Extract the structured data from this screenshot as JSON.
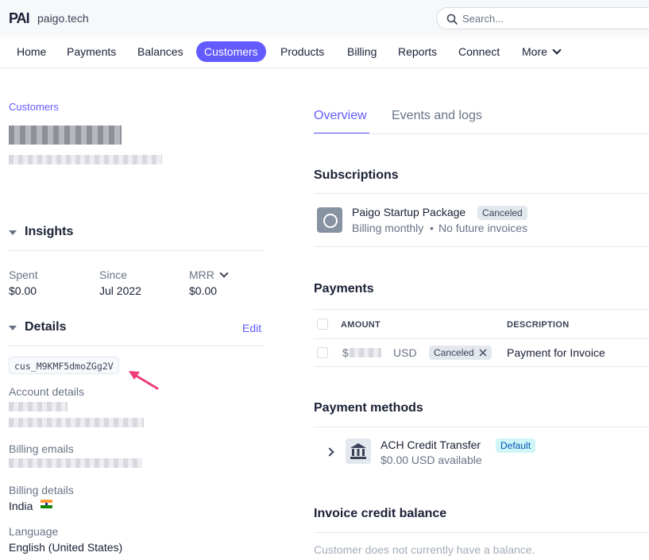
{
  "topbar": {
    "logo_text": "PAI",
    "account_name": "paigo.tech",
    "search_placeholder": "Search..."
  },
  "nav": {
    "items": [
      {
        "label": "Home"
      },
      {
        "label": "Payments"
      },
      {
        "label": "Balances"
      },
      {
        "label": "Customers"
      },
      {
        "label": "Products"
      },
      {
        "label": "Billing"
      },
      {
        "label": "Reports"
      },
      {
        "label": "Connect"
      },
      {
        "label": "More"
      }
    ],
    "active": "Customers"
  },
  "customer": {
    "breadcrumb": "Customers",
    "id": "cus_M9KMF5dmoZGg2V"
  },
  "insights": {
    "title": "Insights",
    "spent_label": "Spent",
    "spent_value": "$0.00",
    "since_label": "Since",
    "since_value": "Jul 2022",
    "mrr_label": "MRR",
    "mrr_value": "$0.00"
  },
  "details": {
    "title": "Details",
    "edit_label": "Edit",
    "account_details_label": "Account details",
    "billing_emails_label": "Billing emails",
    "billing_details_label": "Billing details",
    "billing_country": "India",
    "language_label": "Language",
    "language_value": "English (United States)"
  },
  "tabs": [
    {
      "label": "Overview"
    },
    {
      "label": "Events and logs"
    }
  ],
  "subscriptions": {
    "title": "Subscriptions",
    "name": "Paigo Startup Package",
    "status": "Canceled",
    "billing": "Billing monthly",
    "separator": "•",
    "next_invoice": "No future invoices"
  },
  "payments": {
    "title": "Payments",
    "columns": [
      "AMOUNT",
      "DESCRIPTION"
    ],
    "rows": [
      {
        "amount_prefix": "$",
        "currency": "USD",
        "status": "Canceled",
        "description": "Payment for Invoice"
      }
    ]
  },
  "payment_methods": {
    "title": "Payment methods",
    "name": "ACH Credit Transfer",
    "badge": "Default",
    "available": "$0.00 USD available"
  },
  "invoice_credit": {
    "title": "Invoice credit balance",
    "empty_text": "Customer does not currently have a balance."
  },
  "colors": {
    "accent": "#635bff",
    "flag_saffron": "#ff9933",
    "flag_green": "#138808",
    "annotation_arrow": "#ee3d74"
  }
}
